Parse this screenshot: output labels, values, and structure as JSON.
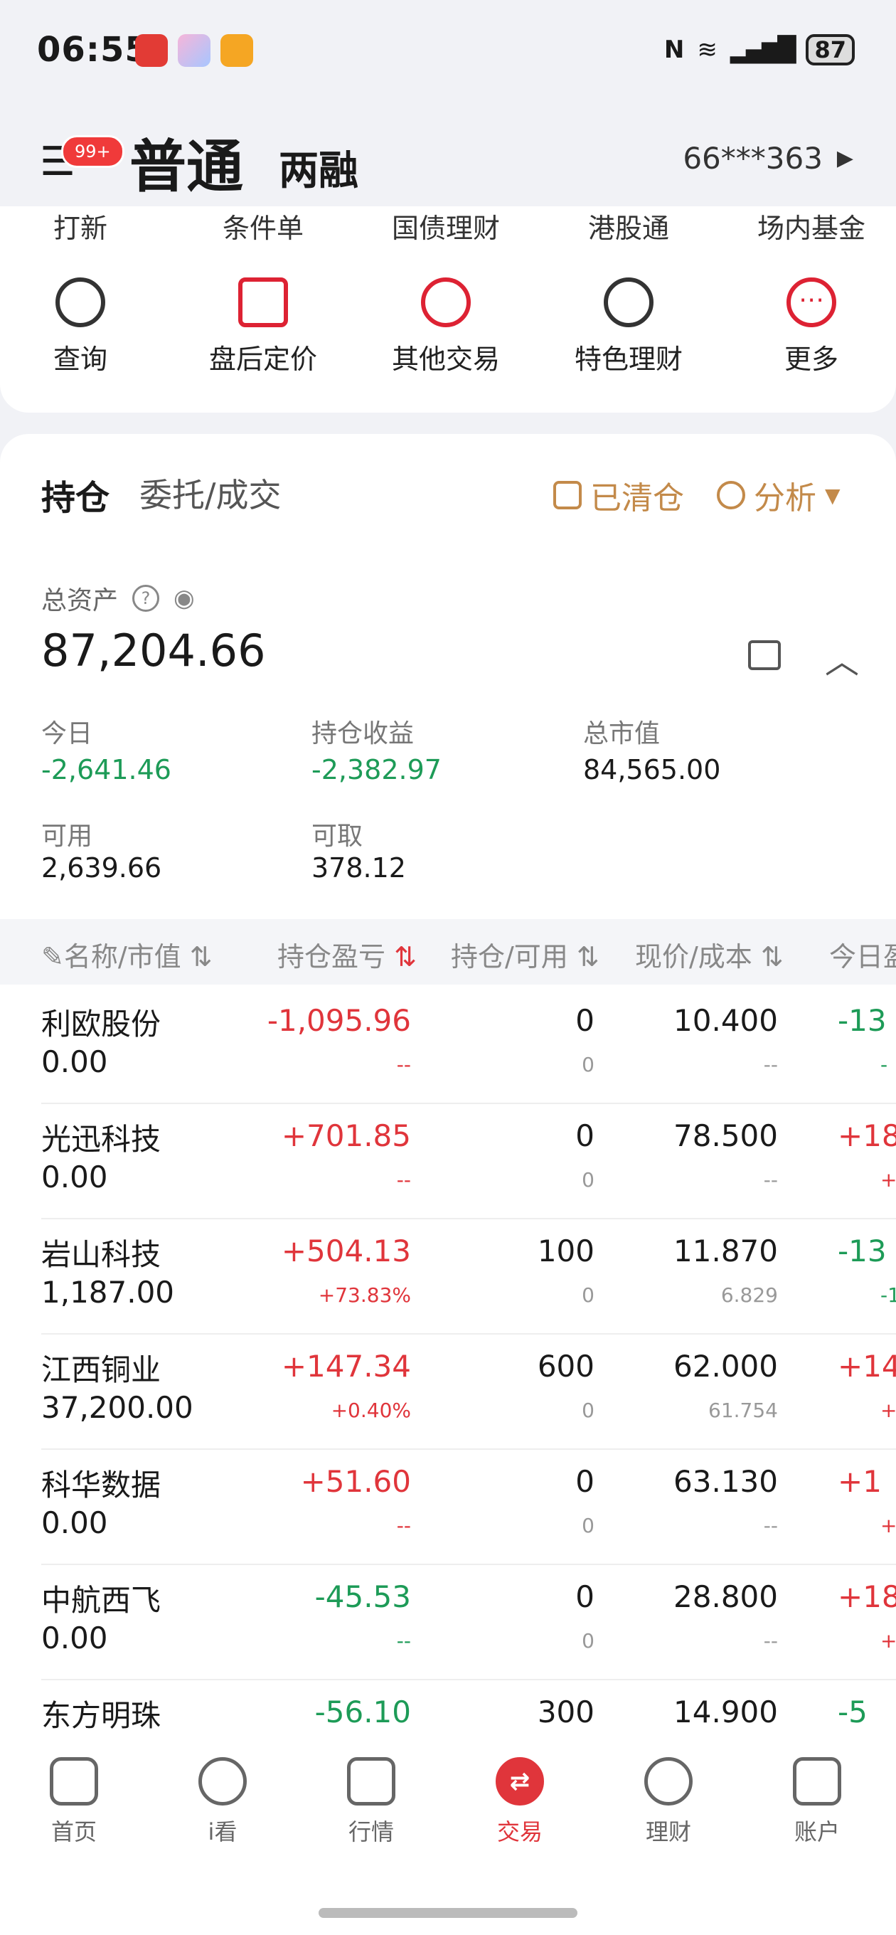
{
  "status": {
    "time": "06:55",
    "battery": "87"
  },
  "header": {
    "title": "普通",
    "tab2": "两融",
    "account": "66***363",
    "badge": "99+"
  },
  "shortcuts": [
    "打新",
    "条件单",
    "国债理财",
    "港股通",
    "场内基金"
  ],
  "functions": [
    "查询",
    "盘后定价",
    "其他交易",
    "特色理财",
    "更多"
  ],
  "tabs": {
    "active": "持仓",
    "inactive": "委托/成交"
  },
  "tools": {
    "cleared": "已清仓",
    "analysis": "分析"
  },
  "assets": {
    "label": "总资产",
    "total": "87,204.66",
    "today_label": "今日",
    "today": "-2,641.46",
    "pos_profit_label": "持仓收益",
    "pos_profit": "-2,382.97",
    "market_label": "总市值",
    "market": "84,565.00",
    "avail_label": "可用",
    "avail": "2,639.66",
    "withdraw_label": "可取",
    "withdraw": "378.12"
  },
  "table": {
    "headers": [
      "名称/市值",
      "持仓盈亏",
      "持仓/可用",
      "现价/成本",
      "今日盈"
    ],
    "rows": [
      {
        "name": "利欧股份",
        "mv": "0.00",
        "pl": "-1,095.96",
        "plp": "--",
        "pos": "0",
        "avail": "0",
        "price": "10.400",
        "cost": "--",
        "today": "-13",
        "todays": "-",
        "color": "red"
      },
      {
        "name": "光迅科技",
        "mv": "0.00",
        "pl": "+701.85",
        "plp": "--",
        "pos": "0",
        "avail": "0",
        "price": "78.500",
        "cost": "--",
        "today": "+18",
        "todays": "+",
        "color": "red"
      },
      {
        "name": "岩山科技",
        "mv": "1,187.00",
        "pl": "+504.13",
        "plp": "+73.83%",
        "pos": "100",
        "avail": "0",
        "price": "11.870",
        "cost": "6.829",
        "today": "-13",
        "todays": "-1",
        "color": "red"
      },
      {
        "name": "江西铜业",
        "mv": "37,200.00",
        "pl": "+147.34",
        "plp": "+0.40%",
        "pos": "600",
        "avail": "0",
        "price": "62.000",
        "cost": "61.754",
        "today": "+14",
        "todays": "+",
        "color": "red"
      },
      {
        "name": "科华数据",
        "mv": "0.00",
        "pl": "+51.60",
        "plp": "--",
        "pos": "0",
        "avail": "0",
        "price": "63.130",
        "cost": "--",
        "today": "+1",
        "todays": "+",
        "color": "red"
      },
      {
        "name": "中航西飞",
        "mv": "0.00",
        "pl": "-45.53",
        "plp": "--",
        "pos": "0",
        "avail": "0",
        "price": "28.800",
        "cost": "--",
        "today": "+18",
        "todays": "+",
        "color": "green"
      },
      {
        "name": "东方明珠",
        "mv": "",
        "pl": "-56.10",
        "plp": "",
        "pos": "300",
        "avail": "",
        "price": "14.900",
        "cost": "",
        "today": "-5",
        "todays": "",
        "color": "green"
      }
    ]
  },
  "nav": [
    "首页",
    "i看",
    "行情",
    "交易",
    "理财",
    "账户"
  ]
}
